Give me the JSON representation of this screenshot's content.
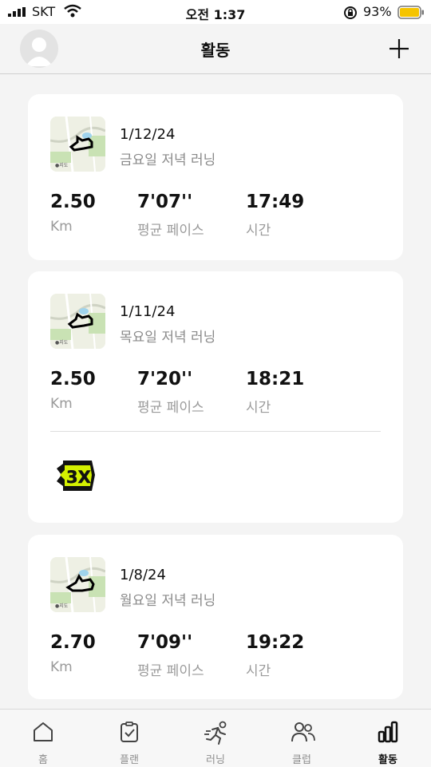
{
  "status_bar": {
    "carrier": "SKT",
    "time": "오전 1:37",
    "battery": "93%"
  },
  "header": {
    "title": "활동",
    "add_icon": "plus-icon",
    "avatar_icon": "person-icon"
  },
  "activities": [
    {
      "date": "1/12/24",
      "name": "금요일 저녁 러닝",
      "distance": "2.50",
      "distance_unit": "Km",
      "pace": "7'07''",
      "pace_label": "평균 페이스",
      "time": "17:49",
      "time_label": "시간"
    },
    {
      "date": "1/11/24",
      "name": "목요일 저녁 러닝",
      "distance": "2.50",
      "distance_unit": "Km",
      "pace": "7'20''",
      "pace_label": "평균 페이스",
      "time": "18:21",
      "time_label": "시간",
      "badge": "3X"
    },
    {
      "date": "1/8/24",
      "name": "월요일 저녁 러닝",
      "distance": "2.70",
      "distance_unit": "Km",
      "pace": "7'09''",
      "pace_label": "평균 페이스",
      "time": "19:22",
      "time_label": "시간"
    }
  ],
  "tab_bar": {
    "tabs": [
      {
        "label": "홈",
        "icon": "home-icon"
      },
      {
        "label": "플랜",
        "icon": "clipboard-check-icon"
      },
      {
        "label": "러닝",
        "icon": "runner-icon"
      },
      {
        "label": "클럽",
        "icon": "people-icon"
      },
      {
        "label": "활동",
        "icon": "bar-chart-icon"
      }
    ],
    "active": "활동"
  },
  "colors": {
    "background": "#f4f4f4",
    "card": "#ffffff",
    "secondary_text": "#9a9a9a",
    "badge_accent": "#d4f000"
  }
}
